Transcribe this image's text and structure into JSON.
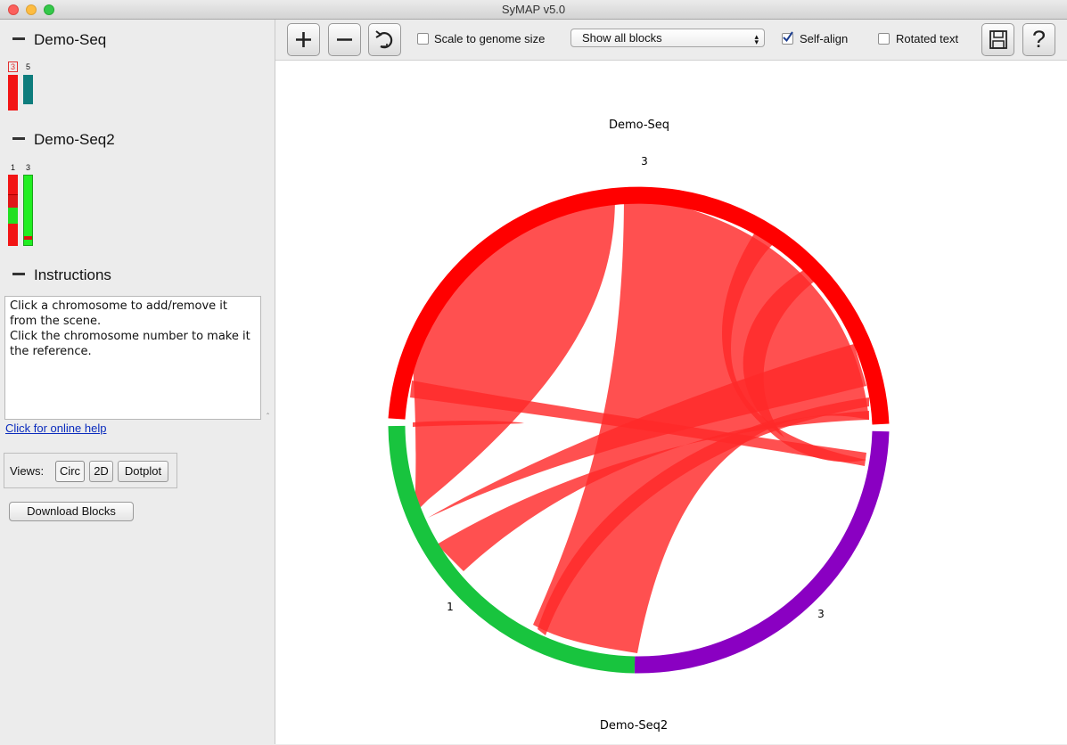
{
  "window": {
    "title": "SyMAP v5.0"
  },
  "sidebar": {
    "projects": [
      {
        "name": "Demo-Seq",
        "chromosomes": [
          {
            "label": "3",
            "color": "#f21515",
            "boxed": true
          },
          {
            "label": "5",
            "color": "#0e7d7d",
            "boxed": false
          }
        ]
      },
      {
        "name": "Demo-Seq2",
        "chromosomes": [
          {
            "label": "1",
            "segments": [
              "#f21515",
              "#ff2020",
              "#22e022",
              "#f21515"
            ]
          },
          {
            "label": "3",
            "segments": [
              "#22ee22",
              "#e01010",
              "#22ee22"
            ]
          }
        ]
      }
    ],
    "instructions": {
      "heading": "Instructions",
      "lines": [
        "Click a chromosome to add/remove it from the scene.",
        "Click the chromosome number to make it the reference."
      ]
    },
    "help_link": "Click for online help",
    "views": {
      "label": "Views:",
      "buttons": [
        "Circ",
        "2D",
        "Dotplot"
      ],
      "selected": "Circ"
    },
    "download_button": "Download Blocks"
  },
  "toolbar": {
    "zoom_in_icon": "plus-icon",
    "zoom_out_icon": "minus-icon",
    "rotate_icon": "rotate-icon",
    "scale_checkbox": {
      "label": "Scale to genome size",
      "checked": false
    },
    "block_select": {
      "value": "Show all blocks"
    },
    "self_align_checkbox": {
      "label": "Self-align",
      "checked": true
    },
    "rotated_text_checkbox": {
      "label": "Rotated text",
      "checked": false
    },
    "save_icon": "save-icon",
    "help_icon": "help-icon"
  },
  "plot": {
    "top_label": "Demo-Seq",
    "bottom_label": "Demo-Seq2",
    "chromosome_labels": [
      "3",
      "1",
      "3"
    ],
    "colors": {
      "seq_chr3": "#ff0000",
      "seq2_chr1": "#18c43e",
      "seq2_chr3": "#8a00c2",
      "ribbon": "#ff2a2a"
    }
  }
}
